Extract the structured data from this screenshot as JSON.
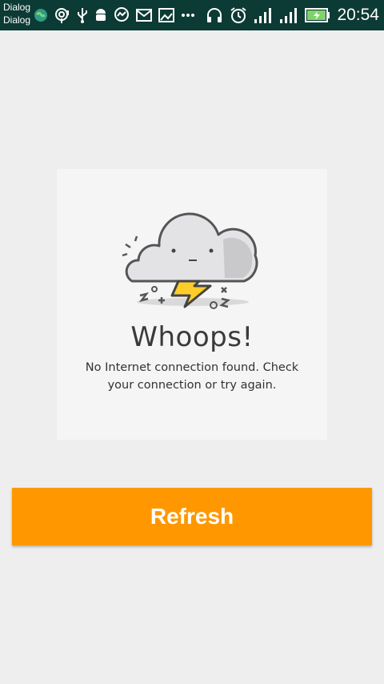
{
  "status_bar": {
    "notification_line1": "Dialog",
    "notification_line2": "Dialog",
    "time": "20:54",
    "icons": [
      "globe-icon",
      "hotspot-icon",
      "usb-icon",
      "android-icon",
      "messenger-icon",
      "mail-icon",
      "mail-image-icon",
      "more-icon",
      "headphones-icon",
      "alarm-icon",
      "signal-icon",
      "signal-icon",
      "battery-icon"
    ],
    "background_color": "#0c3a35"
  },
  "error_card": {
    "title": "Whoops!",
    "message": "No Internet connection found. Check your connection or try again.",
    "illustration": "storm-cloud-illustration"
  },
  "refresh_button": {
    "label": "Refresh",
    "color": "#ff9800"
  }
}
